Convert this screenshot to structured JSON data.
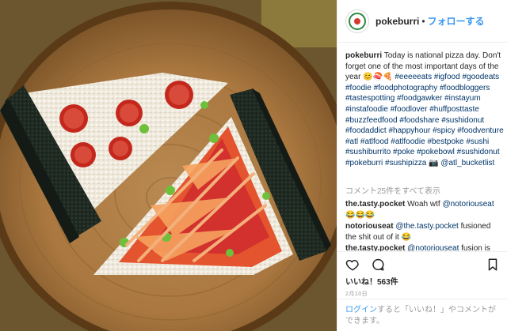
{
  "header": {
    "username": "pokeburri",
    "separator": "•",
    "follow_label": "フォローする"
  },
  "caption": {
    "username": "pokeburri",
    "segments": [
      {
        "t": "text",
        "v": " Today is national pizza day. Don't forget one of the most important days of the year 😊🍣🍕 "
      },
      {
        "t": "tag",
        "v": "#eeeeeats"
      },
      {
        "t": "text",
        "v": " "
      },
      {
        "t": "tag",
        "v": "#igfood"
      },
      {
        "t": "text",
        "v": " "
      },
      {
        "t": "tag",
        "v": "#goodeats"
      },
      {
        "t": "text",
        "v": " "
      },
      {
        "t": "tag",
        "v": "#foodie"
      },
      {
        "t": "text",
        "v": " "
      },
      {
        "t": "tag",
        "v": "#foodphotography"
      },
      {
        "t": "text",
        "v": " "
      },
      {
        "t": "tag",
        "v": "#foodbloggers"
      },
      {
        "t": "text",
        "v": " "
      },
      {
        "t": "tag",
        "v": "#tastespotting"
      },
      {
        "t": "text",
        "v": " "
      },
      {
        "t": "tag",
        "v": "#foodgawker"
      },
      {
        "t": "text",
        "v": " "
      },
      {
        "t": "tag",
        "v": "#instayum"
      },
      {
        "t": "text",
        "v": " "
      },
      {
        "t": "tag",
        "v": "#instafoodie"
      },
      {
        "t": "text",
        "v": " "
      },
      {
        "t": "tag",
        "v": "#foodlover"
      },
      {
        "t": "text",
        "v": " "
      },
      {
        "t": "tag",
        "v": "#huffposttaste"
      },
      {
        "t": "text",
        "v": " "
      },
      {
        "t": "tag",
        "v": "#buzzfeedfood"
      },
      {
        "t": "text",
        "v": " "
      },
      {
        "t": "tag",
        "v": "#foodshare"
      },
      {
        "t": "text",
        "v": " "
      },
      {
        "t": "tag",
        "v": "#sushidonut"
      },
      {
        "t": "text",
        "v": " "
      },
      {
        "t": "tag",
        "v": "#foodaddict"
      },
      {
        "t": "text",
        "v": " "
      },
      {
        "t": "tag",
        "v": "#happyhour"
      },
      {
        "t": "text",
        "v": " "
      },
      {
        "t": "tag",
        "v": "#spicy"
      },
      {
        "t": "text",
        "v": " "
      },
      {
        "t": "tag",
        "v": "#foodventure"
      },
      {
        "t": "text",
        "v": " "
      },
      {
        "t": "tag",
        "v": "#atl"
      },
      {
        "t": "text",
        "v": " "
      },
      {
        "t": "tag",
        "v": "#atlfood"
      },
      {
        "t": "text",
        "v": " "
      },
      {
        "t": "tag",
        "v": "#atlfoodie"
      },
      {
        "t": "text",
        "v": " "
      },
      {
        "t": "tag",
        "v": "#bestpoke"
      },
      {
        "t": "text",
        "v": " "
      },
      {
        "t": "tag",
        "v": "#sushi"
      },
      {
        "t": "text",
        "v": " "
      },
      {
        "t": "tag",
        "v": "#sushiburrito"
      },
      {
        "t": "text",
        "v": " "
      },
      {
        "t": "tag",
        "v": "#poke"
      },
      {
        "t": "text",
        "v": " "
      },
      {
        "t": "tag",
        "v": "#pokebowl"
      },
      {
        "t": "text",
        "v": " "
      },
      {
        "t": "tag",
        "v": "#sushidonut"
      },
      {
        "t": "text",
        "v": " "
      },
      {
        "t": "tag",
        "v": "#pokeburri"
      },
      {
        "t": "text",
        "v": " "
      },
      {
        "t": "tag",
        "v": "#sushipizza"
      },
      {
        "t": "text",
        "v": " 📷 "
      },
      {
        "t": "mention",
        "v": "@atl_bucketlist"
      }
    ]
  },
  "view_all_comments": "コメント25件をすべて表示",
  "comments": [
    {
      "username": "the.tasty.pocket",
      "text": " Woah wtf ",
      "mention": "@notoriouseat",
      "after": " 😂😂😂"
    },
    {
      "username": "notoriouseat",
      "text": " ",
      "mention": "@the.tasty.pocket",
      "after": " fusioned the shit out of it 😂"
    },
    {
      "username": "the.tasty.pocket",
      "text": " ",
      "mention": "@notoriouseat",
      "after": " fusion is"
    }
  ],
  "actions": {
    "like_icon": "heart-icon",
    "comment_icon": "comment-icon",
    "save_icon": "bookmark-icon"
  },
  "likes_text": "いいね！563件",
  "date_text": "2月10日",
  "login_prompt": {
    "link": "ログイン",
    "text": "すると「いいね！」やコメントができます。"
  },
  "colors": {
    "link_blue": "#3897f0",
    "hashtag": "#003569",
    "secondary_text": "#999999"
  }
}
